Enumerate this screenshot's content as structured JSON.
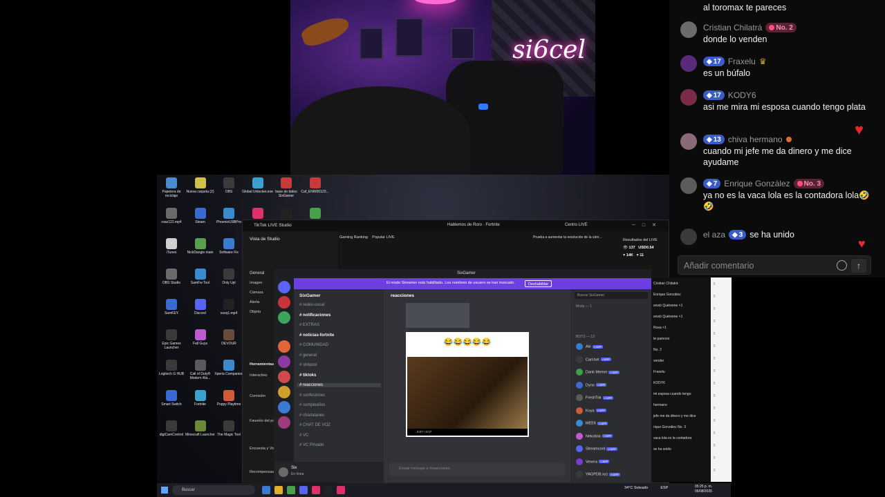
{
  "webcam": {
    "neon_sign": "si6cel"
  },
  "chat": {
    "messages": [
      {
        "user": "",
        "level": "",
        "rank": "",
        "text": "al toromax te pareces"
      },
      {
        "user": "Cristian Chilatrá",
        "level": "",
        "rank": "No. 2",
        "text": "donde lo venden"
      },
      {
        "user": "Fraxelu",
        "level": "17",
        "rank": "",
        "text": "es un búfalo"
      },
      {
        "user": "KODY6",
        "level": "17",
        "rank": "",
        "text": "asi me mira mi esposa cuando tengo plata"
      },
      {
        "user": "chiva hermano",
        "level": "13",
        "rank": "",
        "text": "cuando mi jefe me da dinero y me dice ayudame"
      },
      {
        "user": "Enrique González",
        "level": "7",
        "rank": "No. 3",
        "text": "ya no es la vaca lola es la contadora lola🤣🤣"
      }
    ],
    "join": {
      "user": "el aza",
      "level": "3",
      "text": "se ha unido"
    },
    "comment_placeholder": "Añadir comentario",
    "colors": {
      "heart": "#e5282e",
      "level": "#3a5cc8",
      "rank": "#ff4f7d"
    }
  },
  "desktop": {
    "icons": [
      "Papelera de reciclaje",
      "Nueva carpeta (2)",
      "OBS",
      "Global Unlocker.exe",
      "base de datos SixGamer",
      "Caf_ENW00120...",
      "roaz122.mp4",
      "Steam",
      "PhoenixUSBPro",
      "TikTok LIVE Studio",
      "TikTok",
      "Streamlabs Desktop",
      "iTunes",
      "NickDangle main",
      "Software Fix",
      "OBS Studio",
      "SamFw Tool",
      "Only Upl",
      "SamKEY",
      "Discord",
      "vuvq1.mp4",
      "Epic Games Launcher",
      "Fall Guys",
      "DEVOUR",
      "Logitech G HUB",
      "Call of Duty® Modern Wa...",
      "Xperia Companion",
      "Smart Switch",
      "Fortnite",
      "Poppy Playtime",
      "digiCamControl",
      "Minecraft Launcher",
      "The Magic Tool"
    ]
  },
  "tiktok_studio": {
    "title": "TikTok LIVE Studio",
    "stream_title": "Hablemos de Roro · Fortnite",
    "centro_live": "Centro LIVE",
    "vista": "Vista de Studio",
    "general": "General",
    "sources": [
      "Imagen",
      "Cámara",
      "Alerta",
      "Objeto"
    ],
    "herramientas": "Herramientas",
    "tools": [
      "Interactivo",
      "Comisión",
      "Favorito del público",
      "Encuesta y Votar con...",
      "Recompensas de juegos"
    ],
    "tabs": [
      "Gaming Ranking",
      "Popular LIVE"
    ],
    "notice": "Prueba a aumentar la resolución de la cám...",
    "results_title": "Resultados del LIVE",
    "viewers": "137",
    "usd": "USD0.54",
    "likes": "14K",
    "hearts": "11",
    "status": "CPU: 3.34% · Memoria: 0.26% · Caída: 2/998 fotos · Caída de FPS: 0 · FPS del codificador: 30 · FPS: 30"
  },
  "discord": {
    "title": "SixGamer",
    "banner": "El modo Streamer está habilitado. Los nombres de usuario se han truncado.",
    "banner_button": "Deshabilitar",
    "server": "SixGamer",
    "channels": [
      {
        "name": "redes-socal",
        "style": ""
      },
      {
        "name": "notificaciones",
        "style": "on"
      },
      {
        "name": "EXTRAS",
        "style": ""
      },
      {
        "name": "noticias-fortnite",
        "style": "on"
      },
      {
        "name": "COMUNIDAD",
        "style": ""
      },
      {
        "name": "general",
        "style": ""
      },
      {
        "name": "shitpost",
        "style": ""
      },
      {
        "name": "tiktoks",
        "style": "on"
      },
      {
        "name": "reacciones",
        "style": "sel"
      },
      {
        "name": "confesiones",
        "style": ""
      },
      {
        "name": "cumpleaños",
        "style": ""
      },
      {
        "name": "charlatanes",
        "style": ""
      },
      {
        "name": "CHAT DE VOZ",
        "style": ""
      },
      {
        "name": "VC",
        "style": ""
      },
      {
        "name": "VC Privado",
        "style": ""
      }
    ],
    "current_channel": "reacciones",
    "user_name": "Six",
    "user_status": "En línea",
    "media_emoji": "😂😂😂😂😂",
    "video_time": "0:07 / 0:07",
    "message_placeholder": "Enviar mensaje a #reacciones",
    "member_search": "Buscar SixGamer",
    "mods_header": "Mods — 1",
    "bots_header": "BOTS — 13",
    "members": [
      "Aki",
      "Carl-bot",
      "Dank Memer",
      "Dyno",
      "FreshTok",
      "Koya",
      "MEE6",
      "Nekotina",
      "Streamcord",
      "Vexera",
      "YAGPDB.xyz"
    ]
  },
  "minichat": {
    "lines": [
      "Cristian Chilatrá",
      "Enrique González",
      "envió Quiéreme ×1",
      "envió Quiéreme ×1",
      "Rosa ×1",
      "te pareces",
      "No. 2",
      "vender",
      "Fraxelu",
      "KODY6",
      "mi esposa cuando tengo",
      "hermano",
      "jefe me da dinero y me dice",
      "rique González No. 3",
      "vaca lola es la contadora",
      "se ha unido"
    ]
  },
  "taskbar": {
    "search": "Buscar",
    "weather": "34°C Soleado",
    "lang": "ESP",
    "time": "05:25 p. m.",
    "date": "06/08/2025"
  }
}
